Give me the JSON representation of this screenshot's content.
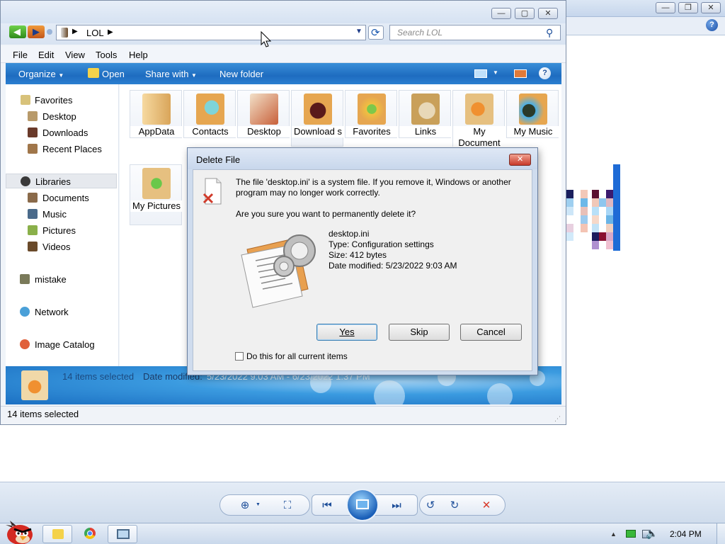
{
  "explorer": {
    "breadcrumb": "LOL",
    "search_placeholder": "Search LOL",
    "menu": [
      "File",
      "Edit",
      "View",
      "Tools",
      "Help"
    ],
    "toolbar": {
      "organize": "Organize",
      "open": "Open",
      "share_with": "Share with",
      "new_folder": "New folder"
    },
    "nav": {
      "favorites": "Favorites",
      "desktop": "Desktop",
      "downloads": "Downloads",
      "recent_places": "Recent Places",
      "libraries": "Libraries",
      "documents": "Documents",
      "music": "Music",
      "pictures": "Pictures",
      "videos": "Videos",
      "mistake": "mistake",
      "network": "Network",
      "image_catalog": "Image Catalog"
    },
    "items": [
      "AppData",
      "Contacts",
      "Desktop",
      "Download s",
      "Favorites",
      "Links",
      "My Document",
      "My Music",
      "My Pictures"
    ],
    "details": {
      "selection": "14 items selected",
      "date_label": "Date modified:",
      "date_range": "5/23/2022 9:03 AM - 6/23/2022 1:37 PM"
    },
    "status": "14 items selected"
  },
  "dialog": {
    "title": "Delete File",
    "message": "The file 'desktop.ini' is a system file. If you remove it, Windows or another program may no longer work correctly.",
    "question": "Are you sure you want to permanently delete it?",
    "file": {
      "name": "desktop.ini",
      "type": "Type: Configuration settings",
      "size": "Size: 412 bytes",
      "modified": "Date modified: 5/23/2022 9:03 AM"
    },
    "yes": "Yes",
    "skip": "Skip",
    "cancel": "Cancel",
    "checkbox_label": "Do this for all current items"
  },
  "taskbar": {
    "clock": "2:04 PM"
  },
  "colors": {
    "toolbar_blue": "#1e6cc0",
    "dialog_frame": "#cfdcee",
    "close_red": "#d9463a"
  }
}
